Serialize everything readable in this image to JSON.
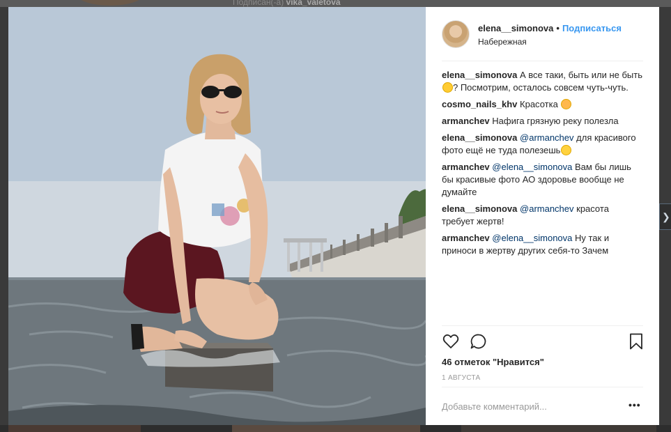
{
  "background": {
    "top_text_prefix": "Подписан(-а) ",
    "top_text_user": "vika_valetova"
  },
  "post": {
    "username": "elena__simonova",
    "follow_label": "Подписаться",
    "location": "Набережная"
  },
  "comments": [
    {
      "user": "elena__simonova",
      "parts": [
        {
          "t": "text",
          "v": "А все таки, быть или не быть"
        },
        {
          "t": "emoji",
          "v": "thinking-face"
        },
        {
          "t": "text",
          "v": "? Посмотрим, осталось совсем чуть-чуть."
        }
      ]
    },
    {
      "user": "cosmo_nails_khv",
      "parts": [
        {
          "t": "text",
          "v": "Красотка "
        },
        {
          "t": "emoji",
          "v": "kissing-face"
        }
      ]
    },
    {
      "user": "armanchev",
      "parts": [
        {
          "t": "text",
          "v": "Нафига грязную реку полезла"
        }
      ]
    },
    {
      "user": "elena__simonova",
      "parts": [
        {
          "t": "mention",
          "v": "@armanchev"
        },
        {
          "t": "text",
          "v": " для красивого фото ещё не туда полезешь"
        },
        {
          "t": "emoji",
          "v": "tears-of-joy-face"
        }
      ]
    },
    {
      "user": "armanchev",
      "parts": [
        {
          "t": "mention",
          "v": "@elena__simonova"
        },
        {
          "t": "text",
          "v": " Вам бы лишь бы красивые фото АО здоровье вообще не думайте"
        }
      ]
    },
    {
      "user": "elena__simonova",
      "parts": [
        {
          "t": "mention",
          "v": "@armanchev"
        },
        {
          "t": "text",
          "v": " красота требует жертв!"
        }
      ]
    },
    {
      "user": "armanchev",
      "parts": [
        {
          "t": "mention",
          "v": "@elena__simonova"
        },
        {
          "t": "text",
          "v": " Ну так и приноси в жертву других себя-то Зачем"
        }
      ]
    }
  ],
  "actions": {
    "like_icon": "heart-icon",
    "comment_icon": "speech-bubble-icon",
    "save_icon": "bookmark-icon"
  },
  "likes_text": "46 отметок \"Нравится\"",
  "date_text": "1 августа",
  "add_comment_placeholder": "Добавьте комментарий...",
  "more_label": "•••",
  "side_arrow": "❯"
}
